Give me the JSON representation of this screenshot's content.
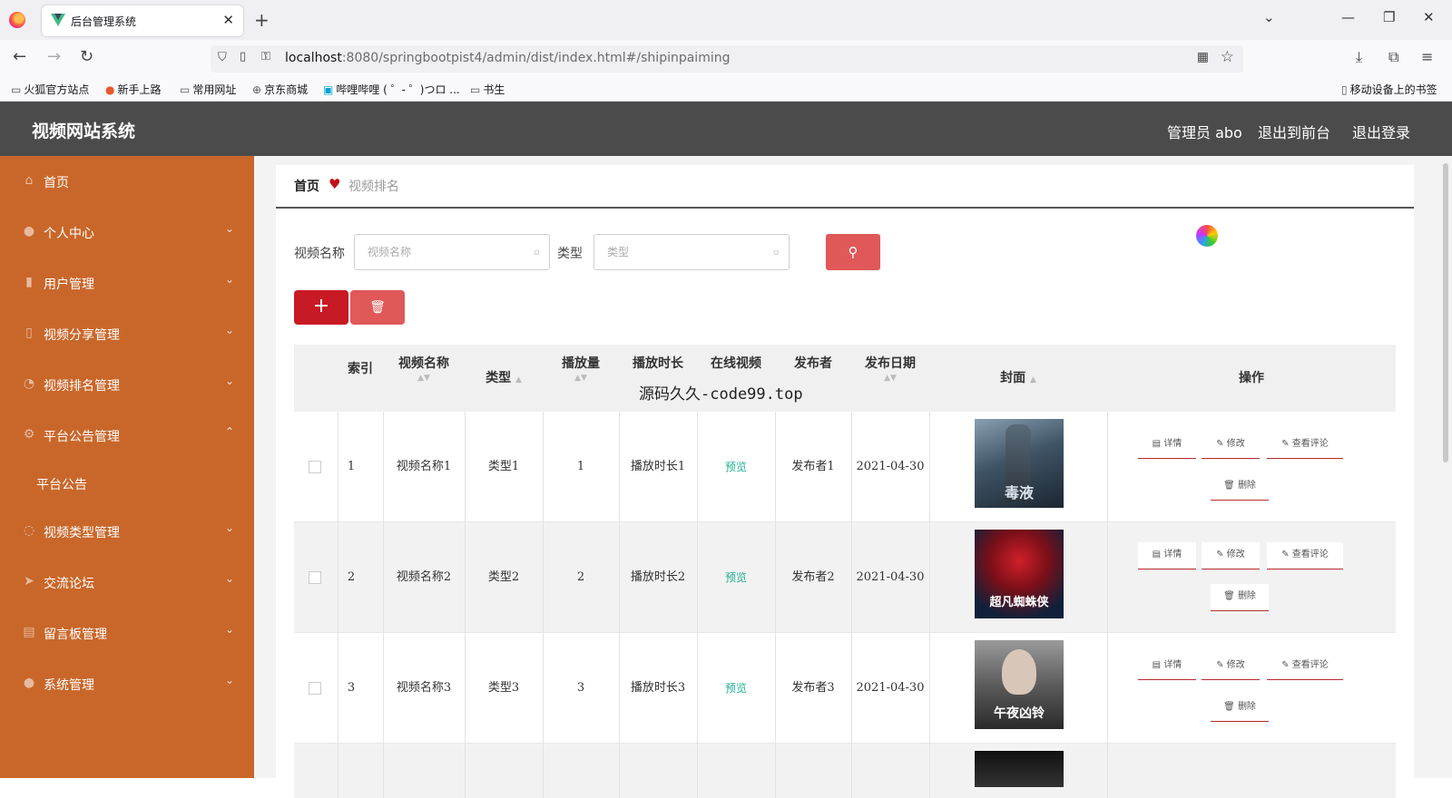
{
  "browser": {
    "tab_title": "后台管理系统",
    "url_host": "localhost",
    "url_rest": ":8080/springbootpist4/admin/dist/index.html#/shipinpaiming",
    "bookmarks": [
      "火狐官方站点",
      "新手上路",
      "常用网址",
      "京东商城",
      "哔哩哔哩 ( ゜- ゜)つロ ...",
      "书生"
    ],
    "mobile_bookmarks": "移动设备上的书签"
  },
  "header": {
    "title": "视频网站系统",
    "user": "管理员 abo",
    "to_front": "退出到前台",
    "logout": "退出登录"
  },
  "sidebar": {
    "items": [
      {
        "label": "首页",
        "icon": "home-icon",
        "arrow": ""
      },
      {
        "label": "个人中心",
        "icon": "user-icon",
        "arrow": "⌄"
      },
      {
        "label": "用户管理",
        "icon": "lock-icon",
        "arrow": "⌄"
      },
      {
        "label": "视频分享管理",
        "icon": "video-icon",
        "arrow": "⌄"
      },
      {
        "label": "视频排名管理",
        "icon": "rank-icon",
        "arrow": "⌄"
      },
      {
        "label": "平台公告管理",
        "icon": "notice-icon",
        "arrow": "⌃"
      },
      {
        "label": "视频类型管理",
        "icon": "type-icon",
        "arrow": "⌄"
      },
      {
        "label": "交流论坛",
        "icon": "forum-icon",
        "arrow": "⌄"
      },
      {
        "label": "留言板管理",
        "icon": "message-icon",
        "arrow": "⌄"
      },
      {
        "label": "系统管理",
        "icon": "system-icon",
        "arrow": "⌄"
      }
    ],
    "sub_item": "平台公告"
  },
  "breadcrumb": {
    "home": "首页",
    "current": "视频排名"
  },
  "search": {
    "name_label": "视频名称",
    "name_placeholder": "视频名称",
    "type_label": "类型",
    "type_placeholder": "类型"
  },
  "table": {
    "headers": [
      "索引",
      "视频名称",
      "类型",
      "播放量",
      "播放时长",
      "在线视频",
      "发布者",
      "发布日期",
      "封面",
      "操作"
    ],
    "rows": [
      {
        "index": "1",
        "name": "视频名称1",
        "type": "类型1",
        "plays": "1",
        "duration": "播放时长1",
        "online": "预览",
        "publisher": "发布者1",
        "date": "2021-04-30",
        "cover_text": "毒液"
      },
      {
        "index": "2",
        "name": "视频名称2",
        "type": "类型2",
        "plays": "2",
        "duration": "播放时长2",
        "online": "预览",
        "publisher": "发布者2",
        "date": "2021-04-30",
        "cover_text": "超凡蜘蛛侠"
      },
      {
        "index": "3",
        "name": "视频名称3",
        "type": "类型3",
        "plays": "3",
        "duration": "播放时长3",
        "online": "预览",
        "publisher": "发布者3",
        "date": "2021-04-30",
        "cover_text": "午夜凶铃"
      }
    ],
    "actions": {
      "detail": "详情",
      "edit": "修改",
      "comments": "查看评论",
      "delete": "删除"
    }
  },
  "watermark": "源码久久-code99.top"
}
